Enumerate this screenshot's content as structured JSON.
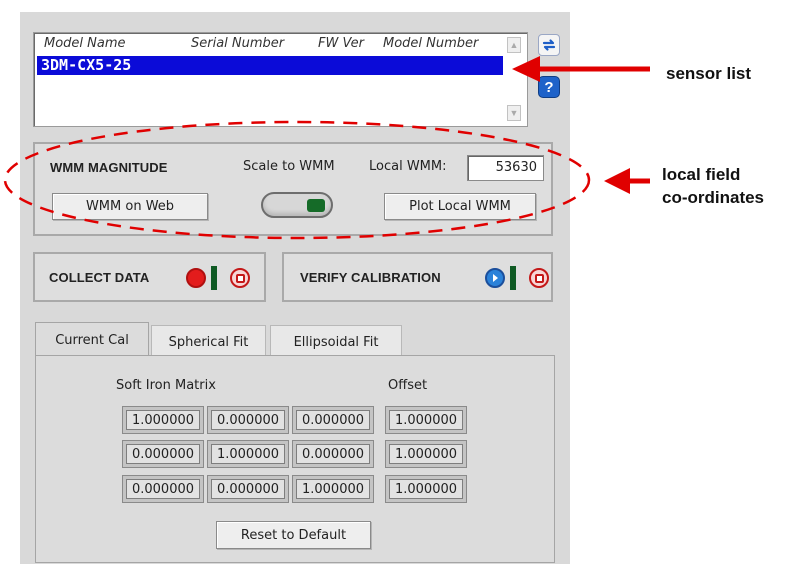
{
  "sensor_list": {
    "headers": [
      "Model Name",
      "Serial Number",
      "FW Ver",
      "Model Number"
    ],
    "rows": [
      {
        "model_name": "3DM-CX5-25"
      }
    ]
  },
  "wmm": {
    "title": "WMM MAGNITUDE",
    "scale_label": "Scale to WMM",
    "local_label": "Local WMM:",
    "local_value": "53630",
    "web_button": "WMM on Web",
    "plot_button": "Plot Local WMM",
    "scale_toggle_on": true
  },
  "collect": {
    "label": "COLLECT DATA"
  },
  "verify": {
    "label": "VERIFY CALIBRATION"
  },
  "tabs": [
    {
      "label": "Current Cal",
      "active": true
    },
    {
      "label": "Spherical Fit",
      "active": false
    },
    {
      "label": "Ellipsoidal Fit",
      "active": false
    }
  ],
  "calibration": {
    "soft_iron_label": "Soft Iron Matrix",
    "offset_label": "Offset",
    "soft_iron": [
      [
        "1.000000",
        "0.000000",
        "0.000000"
      ],
      [
        "0.000000",
        "1.000000",
        "0.000000"
      ],
      [
        "0.000000",
        "0.000000",
        "1.000000"
      ]
    ],
    "offset": [
      "1.000000",
      "1.000000",
      "1.000000"
    ],
    "reset_button": "Reset to Default"
  },
  "annotations": {
    "sensor_list": "sensor list",
    "local_field_line1": "local field",
    "local_field_line2": "co-ordinates"
  },
  "colors": {
    "selection": "#0b0bd8",
    "annotation_red": "#e00000",
    "panel_bg": "#d9d9d9"
  }
}
